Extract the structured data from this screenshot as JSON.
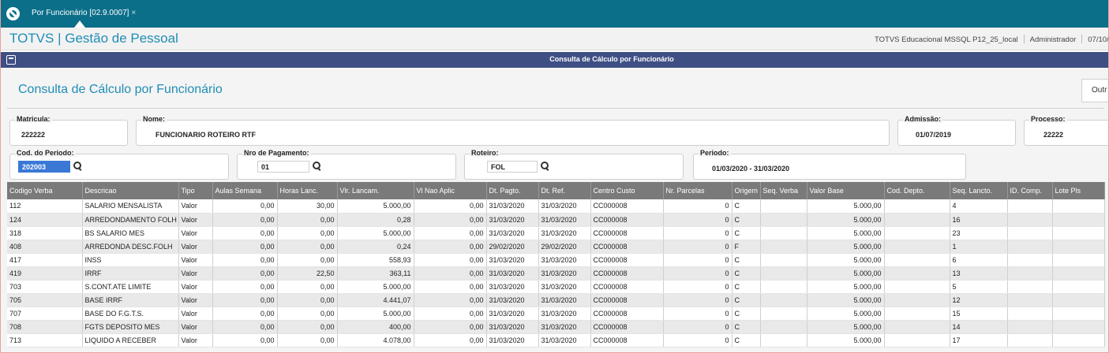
{
  "tabbar": {
    "tab_label": "Por Funcionário [02.9.0007]",
    "close_glyph": "×"
  },
  "header": {
    "title": "TOTVS | Gestão de Pessoal",
    "environment": "TOTVS Educacional MSSQL P12_25_local",
    "user": "Administrador",
    "date_partial": "07/10/"
  },
  "dialog": {
    "title": "Consulta de Cálculo por Funcionário"
  },
  "page": {
    "title": "Consulta de Cálculo por Funcionário",
    "other_button": "Outr"
  },
  "form": {
    "matricula": {
      "label": "Matricula:",
      "value": "222222"
    },
    "nome": {
      "label": "Nome:",
      "value": "FUNCIONARIO ROTEIRO RTF"
    },
    "admissao": {
      "label": "Admissão:",
      "value": "01/07/2019"
    },
    "processo": {
      "label": "Processo:",
      "value": "22222"
    },
    "cod_periodo": {
      "label": "Cod. do Periodo:",
      "value": "202003"
    },
    "nro_pagamento": {
      "label": "Nro de Pagamento:",
      "value": "01"
    },
    "roteiro": {
      "label": "Roteiro:",
      "value": "FOL"
    },
    "periodo": {
      "label": "Periodo:",
      "value": "01/03/2020 - 31/03/2020"
    }
  },
  "grid": {
    "columns": [
      "Codigo Verba",
      "Descricao",
      "Tipo",
      "Aulas Semana",
      "Horas Lanc.",
      "Vlr. Lancam.",
      "Vl Nao Aplic",
      "Dt. Pagto.",
      "Dt. Ref.",
      "Centro Custo",
      "Nr. Parcelas",
      "Origem",
      "Seq. Verba",
      "Valor Base",
      "Cod. Depto.",
      "Seq. Lancto.",
      "ID. Comp.",
      "Lote Pls"
    ],
    "rows": [
      [
        "112",
        "SALARIO MENSALISTA",
        "Valor",
        "0,00",
        "30,00",
        "5.000,00",
        "0,00",
        "31/03/2020",
        "31/03/2020",
        "CC000008",
        "0",
        "C",
        "",
        "5.000,00",
        "",
        "4",
        "",
        ""
      ],
      [
        "124",
        "ARREDONDAMENTO FOLH",
        "Valor",
        "0,00",
        "0,00",
        "0,28",
        "0,00",
        "31/03/2020",
        "31/03/2020",
        "CC000008",
        "0",
        "C",
        "",
        "5.000,00",
        "",
        "16",
        "",
        ""
      ],
      [
        "318",
        "BS SALARIO MES",
        "Valor",
        "0,00",
        "0,00",
        "5.000,00",
        "0,00",
        "31/03/2020",
        "31/03/2020",
        "CC000008",
        "0",
        "C",
        "",
        "5.000,00",
        "",
        "23",
        "",
        ""
      ],
      [
        "408",
        "ARREDONDA DESC.FOLH",
        "Valor",
        "0,00",
        "0,00",
        "0,24",
        "0,00",
        "29/02/2020",
        "29/02/2020",
        "CC000008",
        "0",
        "F",
        "",
        "5.000,00",
        "",
        "1",
        "",
        ""
      ],
      [
        "417",
        "INSS",
        "Valor",
        "0,00",
        "0,00",
        "558,93",
        "0,00",
        "31/03/2020",
        "31/03/2020",
        "CC000008",
        "0",
        "C",
        "",
        "5.000,00",
        "",
        "6",
        "",
        ""
      ],
      [
        "419",
        "IRRF",
        "Valor",
        "0,00",
        "22,50",
        "363,11",
        "0,00",
        "31/03/2020",
        "31/03/2020",
        "CC000008",
        "0",
        "C",
        "",
        "5.000,00",
        "",
        "13",
        "",
        ""
      ],
      [
        "703",
        "S.CONT.ATE LIMITE",
        "Valor",
        "0,00",
        "0,00",
        "5.000,00",
        "0,00",
        "31/03/2020",
        "31/03/2020",
        "CC000008",
        "0",
        "C",
        "",
        "5.000,00",
        "",
        "5",
        "",
        ""
      ],
      [
        "705",
        "BASE IRRF",
        "Valor",
        "0,00",
        "0,00",
        "4.441,07",
        "0,00",
        "31/03/2020",
        "31/03/2020",
        "CC000008",
        "0",
        "C",
        "",
        "5.000,00",
        "",
        "12",
        "",
        ""
      ],
      [
        "707",
        "BASE DO F.G.T.S.",
        "Valor",
        "0,00",
        "0,00",
        "5.000,00",
        "0,00",
        "31/03/2020",
        "31/03/2020",
        "CC000008",
        "0",
        "C",
        "",
        "5.000,00",
        "",
        "15",
        "",
        ""
      ],
      [
        "708",
        "FGTS DEPOSITO MES",
        "Valor",
        "0,00",
        "0,00",
        "400,00",
        "0,00",
        "31/03/2020",
        "31/03/2020",
        "CC000008",
        "0",
        "C",
        "",
        "5.000,00",
        "",
        "14",
        "",
        ""
      ],
      [
        "713",
        "LIQUIDO A RECEBER",
        "Valor",
        "0,00",
        "0,00",
        "4.078,00",
        "0,00",
        "31/03/2020",
        "31/03/2020",
        "CC000008",
        "0",
        "C",
        "",
        "5.000,00",
        "",
        "17",
        "",
        ""
      ]
    ]
  }
}
